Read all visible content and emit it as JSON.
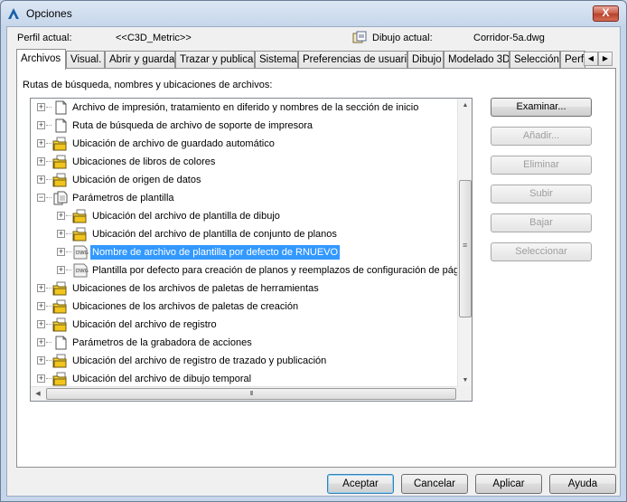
{
  "window": {
    "title": "Opciones",
    "close_label": "X"
  },
  "profile": {
    "profile_label": "Perfil actual:",
    "profile_value": "<<C3D_Metric>>",
    "drawing_label": "Dibujo actual:",
    "drawing_value": "Corridor-5a.dwg"
  },
  "tabs": [
    "Archivos",
    "Visual.",
    "Abrir y guardar",
    "Trazar y publicar",
    "Sistema",
    "Preferencias de usuario",
    "Dibujo",
    "Modelado 3D",
    "Selección",
    "Perf"
  ],
  "active_tab": "Archivos",
  "panel_label": "Rutas de búsqueda, nombres y ubicaciones de archivos:",
  "tree": [
    {
      "label": "Archivo de impresión, tratamiento en diferido y nombres de la sección de inicio",
      "level": 0,
      "icon": "document-icon",
      "expander": "+"
    },
    {
      "label": "Ruta de búsqueda de archivo de soporte de impresora",
      "level": 0,
      "icon": "document-icon",
      "expander": "+"
    },
    {
      "label": "Ubicación de archivo de guardado automático",
      "level": 0,
      "icon": "folder-icon",
      "expander": "+"
    },
    {
      "label": "Ubicaciones de libros de colores",
      "level": 0,
      "icon": "folder-icon",
      "expander": "+"
    },
    {
      "label": "Ubicación de origen de datos",
      "level": 0,
      "icon": "folder-icon",
      "expander": "+"
    },
    {
      "label": "Parámetros de plantilla",
      "level": 0,
      "icon": "documents-icon",
      "expander": "−"
    },
    {
      "label": "Ubicación del archivo de plantilla de dibujo",
      "level": 1,
      "icon": "folder-icon",
      "expander": "+"
    },
    {
      "label": "Ubicación del archivo de plantilla de conjunto de planos",
      "level": 1,
      "icon": "folder-icon",
      "expander": "+"
    },
    {
      "label": "Nombre de archivo de plantilla por defecto de RNUEVO",
      "level": 1,
      "icon": "dwg-file-icon",
      "expander": "+",
      "selected": true
    },
    {
      "label": "Plantilla por defecto para creación de planos y reemplazos de configuración de págin",
      "level": 1,
      "icon": "dwg-file-icon",
      "expander": "+"
    },
    {
      "label": "Ubicaciones de los archivos de paletas de herramientas",
      "level": 0,
      "icon": "folder-icon",
      "expander": "+"
    },
    {
      "label": "Ubicaciones de los archivos de paletas de creación",
      "level": 0,
      "icon": "folder-icon",
      "expander": "+"
    },
    {
      "label": "Ubicación del archivo de registro",
      "level": 0,
      "icon": "folder-icon",
      "expander": "+"
    },
    {
      "label": "Parámetros de la grabadora de acciones",
      "level": 0,
      "icon": "document-icon",
      "expander": "+"
    },
    {
      "label": "Ubicación del archivo de registro de trazado y publicación",
      "level": 0,
      "icon": "folder-icon",
      "expander": "+"
    },
    {
      "label": "Ubicación del archivo de dibujo temporal",
      "level": 0,
      "icon": "folder-icon",
      "expander": "+"
    }
  ],
  "side_buttons": [
    {
      "label": "Examinar...",
      "enabled": true
    },
    {
      "label": "Añadir...",
      "enabled": false
    },
    {
      "label": "Eliminar",
      "enabled": false
    },
    {
      "label": "Subir",
      "enabled": false
    },
    {
      "label": "Bajar",
      "enabled": false
    },
    {
      "label": "Seleccionar",
      "enabled": false
    }
  ],
  "bottom_buttons": {
    "accept": "Aceptar",
    "cancel": "Cancelar",
    "apply": "Aplicar",
    "help": "Ayuda"
  },
  "scroll": {
    "hscroll_grip": "III",
    "vscroll_grip": "≡"
  }
}
